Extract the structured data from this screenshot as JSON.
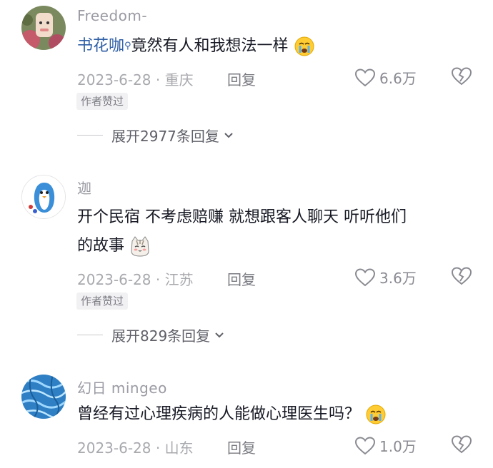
{
  "comments": [
    {
      "username": "Freedom-",
      "mention": "书花咖",
      "text": "竟然有人和我想法一样",
      "emoji": "crying-face",
      "date": "2023-6-28",
      "location": "重庆",
      "reply_label": "回复",
      "likes": "6.6万",
      "badge": "作者赞过",
      "expand_label": "展开2977条回复"
    },
    {
      "username": "迦",
      "text_line1": "开个民宿 不考虑赔赚 就想跟客人聊天 听听他们",
      "text_line2": "的故事",
      "emoji": "cat-face",
      "date": "2023-6-28",
      "location": "江苏",
      "reply_label": "回复",
      "likes": "3.6万",
      "badge": "作者赞过",
      "expand_label": "展开829条回复"
    },
    {
      "username": "幻日 mingeo",
      "text": "曾经有过心理疾病的人能做心理医生吗？",
      "emoji": "crying-face",
      "date": "2023-6-28",
      "location": "山东",
      "reply_label": "回复",
      "likes": "1.0万"
    }
  ],
  "colors": {
    "mention": "#2f5fa6",
    "meta_text": "#a8a9ae",
    "badge_bg": "#f1f1f3"
  }
}
